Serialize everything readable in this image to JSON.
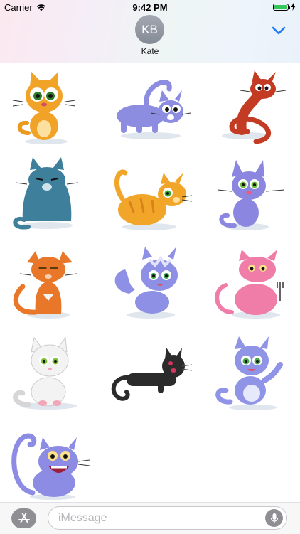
{
  "status_bar": {
    "carrier": "Carrier",
    "time": "9:42 PM",
    "battery_level": 1.0,
    "battery_color": "#34c759"
  },
  "header": {
    "avatar_initials": "KB",
    "contact_name": "Kate",
    "collapse_icon": "chevron-down-icon",
    "accent_color": "#1e7cf2"
  },
  "stickers": [
    {
      "name": "Orange kitten sitting",
      "color": "#f0a326"
    },
    {
      "name": "Blue cat walking",
      "color": "#8c8ce0"
    },
    {
      "name": "Red cat curled tail",
      "color": "#c23b22"
    },
    {
      "name": "Teal grumpy cat",
      "color": "#3e7f9c"
    },
    {
      "name": "Orange striped cat crouching",
      "color": "#f2a629"
    },
    {
      "name": "Blue cat with whiskers",
      "color": "#8b86df"
    },
    {
      "name": "Orange cat sitting tall",
      "color": "#e9772a"
    },
    {
      "name": "Blue fluffy kitten",
      "color": "#8d90e4"
    },
    {
      "name": "Pink cat with fork",
      "color": "#ef7da8"
    },
    {
      "name": "White kitten sitting",
      "color": "#f3f3f3"
    },
    {
      "name": "Black cat lying",
      "color": "#2b2b2b"
    },
    {
      "name": "Blue kitten waving",
      "color": "#8f94e6"
    },
    {
      "name": "Blue cat laughing",
      "color": "#8c8ce4"
    }
  ],
  "bottom_bar": {
    "app_store_icon": "app-store-icon",
    "message_placeholder": "iMessage",
    "message_value": "",
    "mic_icon": "microphone-icon"
  }
}
